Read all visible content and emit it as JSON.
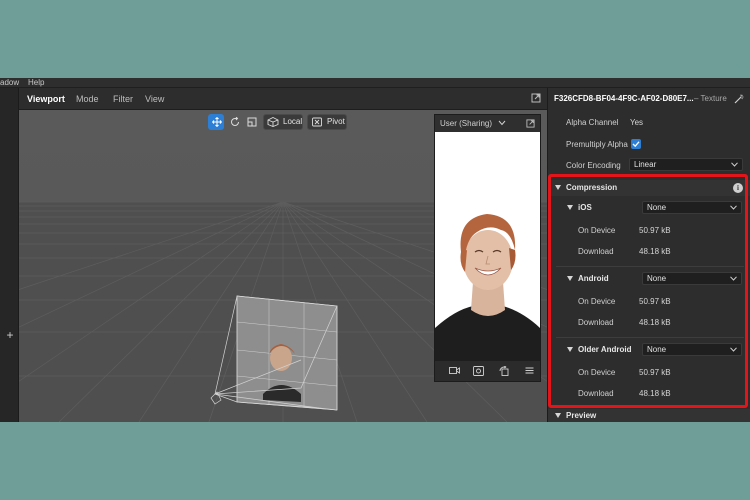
{
  "menu": {
    "items": [
      "adow",
      "Help"
    ]
  },
  "viewport": {
    "tabs": [
      "Viewport",
      "Mode",
      "Filter",
      "View"
    ],
    "tools": {
      "local_label": "Local",
      "pivot_label": "Pivot"
    },
    "preview": {
      "title": "User (Sharing)"
    }
  },
  "inspector": {
    "title": "F326CFD8-BF04-4F9C-AF02-D80E7...",
    "type": "– Texture",
    "alpha_channel": {
      "label": "Alpha Channel",
      "value": "Yes"
    },
    "premultiply_alpha": {
      "label": "Premultiply Alpha",
      "checked": true
    },
    "color_encoding": {
      "label": "Color Encoding",
      "value": "Linear"
    },
    "compression": {
      "label": "Compression",
      "platforms": [
        {
          "name": "iOS",
          "setting": "None",
          "on_device_label": "On Device",
          "on_device": "50.97 kB",
          "download_label": "Download",
          "download": "48.18 kB"
        },
        {
          "name": "Android",
          "setting": "None",
          "on_device_label": "On Device",
          "on_device": "50.97 kB",
          "download_label": "Download",
          "download": "48.18 kB"
        },
        {
          "name": "Older Android",
          "setting": "None",
          "on_device_label": "On Device",
          "on_device": "50.97 kB",
          "download_label": "Download",
          "download": "48.18 kB"
        }
      ]
    },
    "preview_section": {
      "label": "Preview"
    }
  },
  "colors": {
    "accent": "#2d7fd6",
    "highlight": "#e3151b",
    "outer_background": "#6f9e99"
  }
}
